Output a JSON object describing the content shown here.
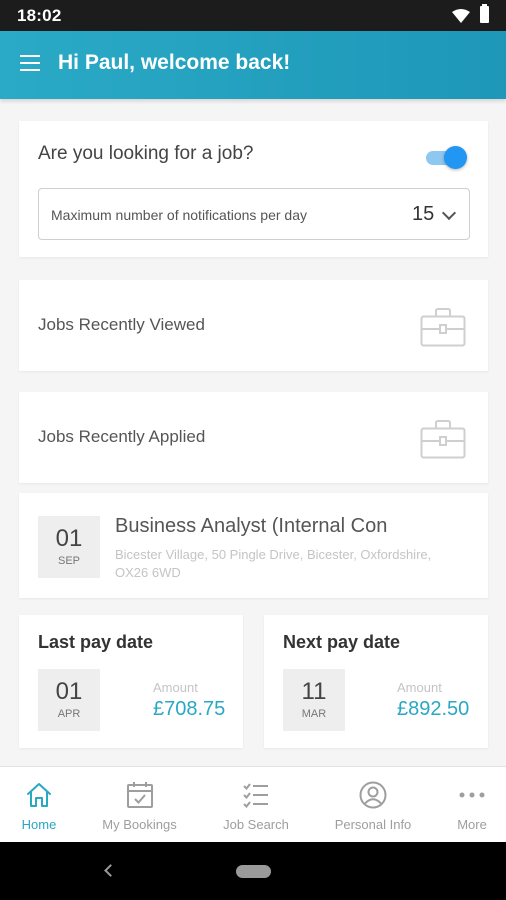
{
  "status_bar": {
    "time": "18:02"
  },
  "header": {
    "title": "Hi Paul, welcome back!"
  },
  "job_search": {
    "question": "Are you looking for a job?",
    "toggle_on": true,
    "notifications_label": "Maximum number of notifications per day",
    "notifications_value": "15"
  },
  "recent": {
    "viewed_label": "Jobs Recently Viewed",
    "applied_label": "Jobs Recently Applied"
  },
  "booking": {
    "day": "01",
    "month": "SEP",
    "title": "Business Analyst (Internal Con",
    "address": "Bicester Village, 50 Pingle Drive, Bicester, Oxfordshire, OX26 6WD"
  },
  "pay": {
    "last": {
      "title": "Last pay date",
      "day": "01",
      "month": "APR",
      "amount_label": "Amount",
      "amount": "£708.75"
    },
    "next": {
      "title": "Next pay date",
      "day": "11",
      "month": "MAR",
      "amount_label": "Amount",
      "amount": "£892.50"
    }
  },
  "nav": {
    "items": [
      {
        "label": "Home",
        "icon": "home-icon",
        "active": true
      },
      {
        "label": "My Bookings",
        "icon": "calendar-icon",
        "active": false
      },
      {
        "label": "Job Search",
        "icon": "checklist-icon",
        "active": false
      },
      {
        "label": "Personal Info",
        "icon": "user-icon",
        "active": false
      },
      {
        "label": "More",
        "icon": "more-icon",
        "active": false
      }
    ]
  },
  "colors": {
    "accent": "#29a8c4",
    "toggle": "#2196f3",
    "header": "#23a1c0"
  }
}
